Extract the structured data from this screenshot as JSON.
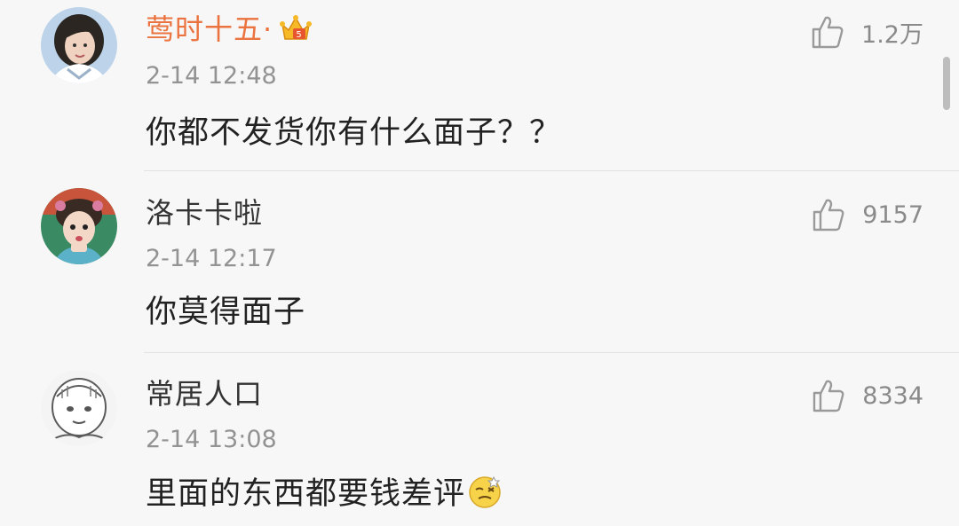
{
  "comments": [
    {
      "username": "莺时十五·",
      "vip_badge_icon": "crown-icon",
      "username_color": "#eb7340",
      "timestamp": "2-14 12:48",
      "content": "你都不发货你有什么面子？？",
      "like_count": "1.2万",
      "avatar_icon": "avatar-girl-icon"
    },
    {
      "username": "洛卡卡啦",
      "username_color": "#333333",
      "timestamp": "2-14 12:17",
      "content": "你莫得面子",
      "like_count": "9157",
      "avatar_icon": "avatar-costume-girl-icon"
    },
    {
      "username": "常居人口",
      "username_color": "#333333",
      "timestamp": "2-14 13:08",
      "content": "里面的东西都要钱差评",
      "content_emoji_icon": "dizzy-face-emoji-icon",
      "like_count": "8334",
      "avatar_icon": "avatar-sketch-icon"
    }
  ],
  "colors": {
    "background": "#f7f7f7",
    "divider": "#e2e2e2",
    "vip_name": "#eb7340",
    "timestamp": "#939393",
    "like_icon": "#9a9a9a"
  }
}
